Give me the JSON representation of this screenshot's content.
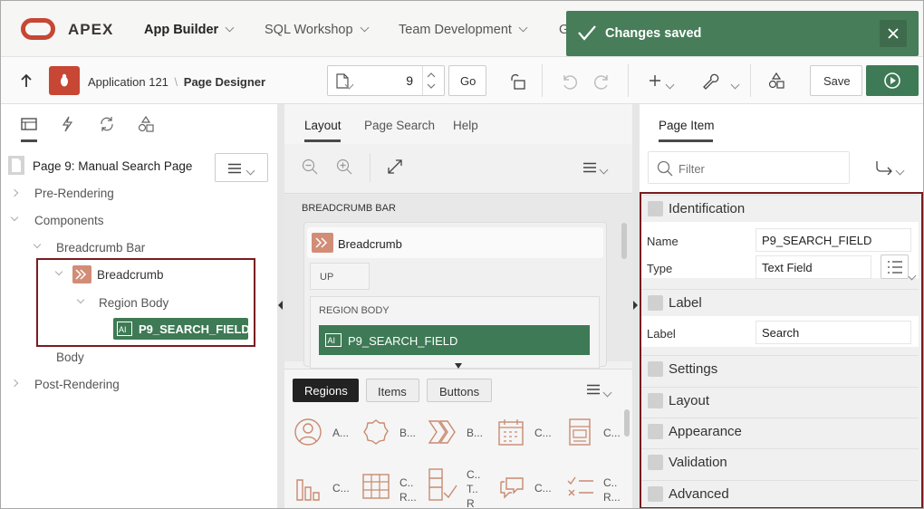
{
  "header": {
    "brand": "APEX",
    "nav": [
      {
        "label": "App Builder"
      },
      {
        "label": "SQL Workshop"
      },
      {
        "label": "Team Development"
      },
      {
        "label": "G"
      }
    ]
  },
  "toast": {
    "message": "Changes saved"
  },
  "toolbar": {
    "app_name": "Application 121",
    "separator": "\\",
    "current": "Page Designer",
    "page_number": "9",
    "go_label": "Go",
    "save_label": "Save"
  },
  "left_panel": {
    "page_title": "Page 9: Manual Search Page",
    "tree": {
      "pre_rendering": "Pre-Rendering",
      "components": "Components",
      "breadcrumb_bar": "Breadcrumb Bar",
      "breadcrumb": "Breadcrumb",
      "region_body": "Region Body",
      "item": "P9_SEARCH_FIELD",
      "body": "Body",
      "post_rendering": "Post-Rendering"
    }
  },
  "middle_panel": {
    "tabs": [
      "Layout",
      "Page Search",
      "Help"
    ],
    "layout": {
      "breadcrumb_bar": "BREADCRUMB BAR",
      "breadcrumb": "Breadcrumb",
      "up": "UP",
      "region_body": "REGION BODY",
      "item": "P9_SEARCH_FIELD"
    },
    "gallery_tabs": [
      "Regions",
      "Items",
      "Buttons"
    ],
    "gallery": [
      {
        "label": "A..."
      },
      {
        "label": "B..."
      },
      {
        "label": "B..."
      },
      {
        "label": "C..."
      },
      {
        "label": "C..."
      },
      {
        "label": "C..."
      },
      {
        "label1": "C..",
        "label2": "R..."
      },
      {
        "label1": "C..",
        "label2": "T..",
        "label3": "R"
      },
      {
        "label": "C..."
      },
      {
        "label1": "C..",
        "label2": "R..."
      }
    ]
  },
  "right_panel": {
    "tab": "Page Item",
    "filter_placeholder": "Filter",
    "groups": {
      "identification": "Identification",
      "label": "Label",
      "settings": "Settings",
      "layout": "Layout",
      "appearance": "Appearance",
      "validation": "Validation",
      "advanced": "Advanced"
    },
    "name_label": "Name",
    "name_value": "P9_SEARCH_FIELD",
    "type_label": "Type",
    "type_value": "Text Field",
    "label_label": "Label",
    "label_value": "Search"
  },
  "colors": {
    "brand": "#c74634",
    "success": "#477d59",
    "highlight": "#3e7a55",
    "callout": "#7a1b1f"
  }
}
